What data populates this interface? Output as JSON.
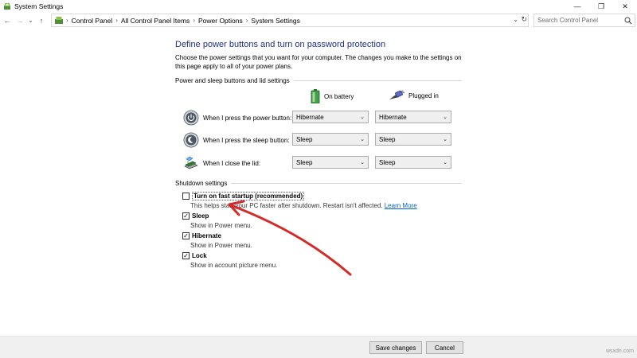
{
  "window": {
    "title": "System Settings",
    "controls": {
      "minimize": "—",
      "maximize": "❐",
      "close": "✕"
    }
  },
  "nav": {
    "back": "←",
    "forward": "→",
    "recent": "⌄",
    "up": "↑",
    "breadcrumbs": [
      "Control Panel",
      "All Control Panel Items",
      "Power Options",
      "System Settings"
    ],
    "separator": "›",
    "dropdown": "⌄",
    "refresh": "↻",
    "search_placeholder": "Search Control Panel"
  },
  "main": {
    "title": "Define power buttons and turn on password protection",
    "intro": "Choose the power settings that you want for your computer. The changes you make to the settings on this page apply to all of your power plans.",
    "power_section": {
      "heading": "Power and sleep buttons and lid settings",
      "col_battery": "On battery",
      "col_plugged": "Plugged in",
      "rows": [
        {
          "label": "When I press the power button:",
          "battery": "Hibernate",
          "plugged": "Hibernate"
        },
        {
          "label": "When I press the sleep button:",
          "battery": "Sleep",
          "plugged": "Sleep"
        },
        {
          "label": "When I close the lid:",
          "battery": "Sleep",
          "plugged": "Sleep"
        }
      ]
    },
    "shutdown_section": {
      "heading": "Shutdown settings",
      "fast_startup": {
        "label": "Turn on fast startup (recommended)",
        "desc": "This helps start your PC faster after shutdown. Restart isn't affected.",
        "link": "Learn More",
        "checked": false
      },
      "sleep": {
        "label": "Sleep",
        "desc": "Show in Power menu.",
        "checked": true
      },
      "hibernate": {
        "label": "Hibernate",
        "desc": "Show in Power menu.",
        "checked": true
      },
      "lock": {
        "label": "Lock",
        "desc": "Show in account picture menu.",
        "checked": true
      },
      "check_mark": "✓"
    }
  },
  "footer": {
    "save": "Save changes",
    "cancel": "Cancel",
    "watermark": "wsxdn.com"
  },
  "colors": {
    "title_blue": "#1e3287",
    "link_blue": "#0066cc",
    "annotation_red": "#d42a2a"
  }
}
